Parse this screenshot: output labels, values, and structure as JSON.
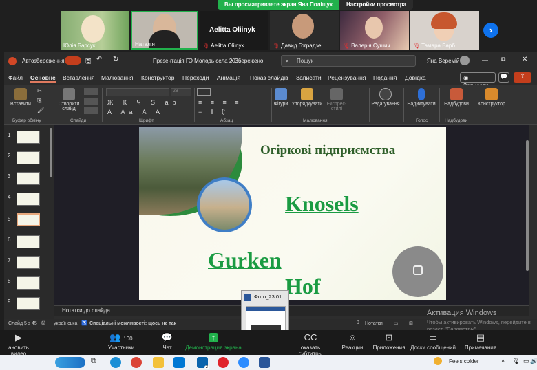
{
  "banner": {
    "viewing": "Вы просматриваете экран Яна Поліщук",
    "options": "Настройки просмотра"
  },
  "participants": [
    {
      "name": "Юлія Барсук",
      "muted": false
    },
    {
      "name": "Наталія",
      "muted": false
    },
    {
      "name": "Aelitta Oliinyk",
      "muted": true,
      "big_name": "Aelitta Oliinyk"
    },
    {
      "name": "Давид Гоградзе",
      "muted": true
    },
    {
      "name": "Валерія Сушич",
      "muted": true
    },
    {
      "name": "Тамара Барб",
      "muted": true
    }
  ],
  "ppt": {
    "autosave": "Автозбереження",
    "doc_title": "Презентація ГО Молодь села 20...",
    "saved": "• Збережено",
    "search_placeholder": "Пошук",
    "user": "Яна Веремій",
    "menu": [
      "Файл",
      "Основне",
      "Вставлення",
      "Малювання",
      "Конструктор",
      "Переходи",
      "Анімація",
      "Показ слайдів",
      "Записати",
      "Рецензування",
      "Подання",
      "Довідка"
    ],
    "record_btn": "Записати",
    "ribbon": {
      "paste": "Вставити",
      "clipboard": "Буфер обміну",
      "new_slide": "Створити слайд",
      "slides": "Слайди",
      "font": "Шрифт",
      "font_size": "28",
      "paragraph": "Абзац",
      "shapes": "Фігури",
      "arrange": "Упорядкувати",
      "quick_styles": "Експрес-стилі",
      "drawing": "Малювання",
      "editing": "Редагування",
      "dictate": "Надиктувати",
      "voice": "Голос",
      "designer": "Надбудови",
      "addins": "Надбудови",
      "designer2": "Конструктор"
    },
    "slide": {
      "heading": "Огіркові підприємства",
      "brand1": "Knosels",
      "brand2_line1": "Gurken",
      "brand2_line2": "Hof"
    },
    "slide_numbers": [
      "1",
      "2",
      "3",
      "4",
      "5",
      "6",
      "7",
      "8",
      "9"
    ],
    "notes": "Нотатки до слайда",
    "status": {
      "slide": "Слайд 5 з 45",
      "lang": "українська",
      "access": "Спеціальні можливості: щось не так",
      "notes_btn": "Нотатки"
    }
  },
  "popup": {
    "title": "Фото_23.01...."
  },
  "watermark": {
    "line1": "Активация Windows",
    "line2": "Чтобы активировать Windows, перейдите в раздел \"Параметры\"."
  },
  "zoom": {
    "stop_video": "ановить видео",
    "participants": "Участники",
    "participants_count": "100",
    "chat": "Чат",
    "share": "Демонстрация экрана",
    "subtitles": "оказать субтитры",
    "reactions": "Реакции",
    "apps": "Приложения",
    "whiteboard": "Доски сообщений",
    "notes": "Примечания",
    "cc": "CC"
  },
  "taskbar": {
    "weather": "Feels colder",
    "mail_badge": "2"
  },
  "colors": {
    "accent_green": "#1a9b42",
    "heading_green": "#2f5f2a",
    "zoom_blue": "#0e72ed"
  }
}
